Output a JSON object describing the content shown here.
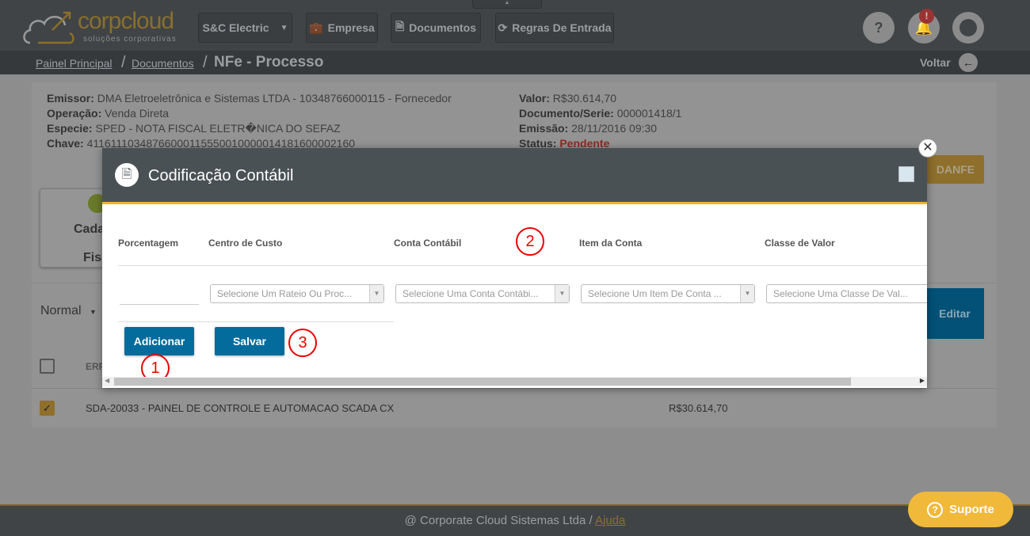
{
  "header": {
    "logo_text": "corpcloud",
    "logo_sub": "soluções corporativas",
    "company": "S&C Electric",
    "nav": [
      {
        "label": "Empresa",
        "icon": "briefcase-icon"
      },
      {
        "label": "Documentos",
        "icon": "document-icon"
      },
      {
        "label": "Regras De Entrada",
        "icon": "refresh-icon"
      }
    ],
    "help": "?",
    "notif_badge": "!"
  },
  "breadcrumb": {
    "items": [
      "Painel Principal",
      "Documentos"
    ],
    "current": "NFe - Processo",
    "back": "Voltar"
  },
  "doc": {
    "left": [
      {
        "k": "Emissor:",
        "v": " DMA Eletroeletrônica e Sistemas LTDA - 10348766000115 - Fornecedor"
      },
      {
        "k": "Operação:",
        "v": " Venda Direta"
      },
      {
        "k": "Especie:",
        "v": " SPED - NOTA FISCAL ELETR�NICA DO SEFAZ"
      },
      {
        "k": "Chave:",
        "v": " 41161110348766000115550010000014181600002160"
      }
    ],
    "right": [
      {
        "k": "Valor:",
        "v": " R$30.614,70"
      },
      {
        "k": "Documento/Serie:",
        "v": " 000001418/1"
      },
      {
        "k": "Emissão:",
        "v": " 28/11/2016 09:30"
      },
      {
        "k": "Status:",
        "v": " Pendente"
      }
    ],
    "status_color": "#c0392b",
    "danfe": "DANFE",
    "tab_line1": "Cada",
    "tab_line2": "Fisc",
    "view": "Normal",
    "edit": "Editar",
    "col_erp": "ERP",
    "row_desc": "SDA-20033 - PAINEL DE CONTROLE E AUTOMACAO SCADA CX",
    "row_value": "R$30.614,70"
  },
  "modal": {
    "title": "Codificação Contábil",
    "columns": [
      "Porcentagem",
      "Centro de Custo",
      "Conta Contábil",
      "Item da Conta",
      "Classe de Valor"
    ],
    "selects": [
      "Selecione Um Rateio Ou Proc...",
      "Selecione Uma Conta Contábi...",
      "Selecione Um Item De Conta ...",
      "Selecione Uma Classe De Val..."
    ],
    "add": "Adicionar",
    "save": "Salvar",
    "markers": [
      "1",
      "2",
      "3"
    ]
  },
  "footer": {
    "text": "@ Corporate Cloud Sistemas Ltda / ",
    "link": "Ajuda",
    "support": "Suporte"
  }
}
